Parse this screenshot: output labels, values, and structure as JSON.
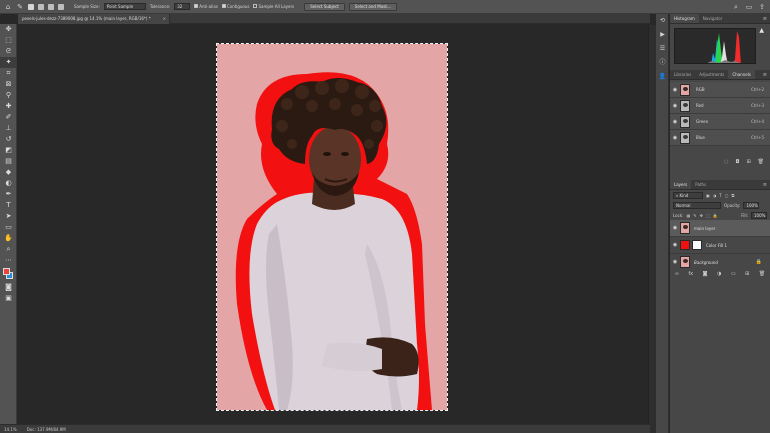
{
  "options_bar": {
    "sample_size_label": "Sample Size:",
    "sample_size_value": "Point Sample",
    "tolerance_label": "Tolerance:",
    "tolerance_value": "32",
    "anti_alias_label": "Anti-alias",
    "contiguous_label": "Contiguous",
    "sample_all_layers_label": "Sample All Layers",
    "select_subject_label": "Select Subject",
    "select_and_mask_label": "Select and Mask..."
  },
  "document_tab": {
    "title": "pexels-jules-dezz-7389008.jpg @ 14.1% (main layer, RGB/16*) *",
    "close": "×"
  },
  "status_bar": {
    "zoom": "14.1%",
    "doc_info": "Doc: 137.9M/84.9M"
  },
  "right_panel": {
    "top_tabs": [
      "Histogram",
      "Navigator"
    ],
    "mid_tabs": [
      "Libraries",
      "Adjustments",
      "Channels"
    ],
    "channels": [
      {
        "name": "RGB",
        "shortcut": "Ctrl+2"
      },
      {
        "name": "Red",
        "shortcut": "Ctrl+3"
      },
      {
        "name": "Green",
        "shortcut": "Ctrl+4"
      },
      {
        "name": "Blue",
        "shortcut": "Ctrl+5"
      }
    ],
    "layers_tabs": [
      "Layers",
      "Paths"
    ],
    "kind_label": "Kind",
    "blend_mode": "Normal",
    "opacity_label": "Opacity:",
    "opacity_value": "100%",
    "lock_label": "Lock:",
    "fill_label": "Fill:",
    "fill_value": "100%",
    "layers": [
      {
        "name": "main layer"
      },
      {
        "name": "Color Fill 1"
      },
      {
        "name": "Background"
      }
    ]
  },
  "colors": {
    "foreground": "#e8443a",
    "background": "#2a8fd6",
    "selection_fill": "#f21010",
    "photo_background": "#e3a5a6"
  }
}
